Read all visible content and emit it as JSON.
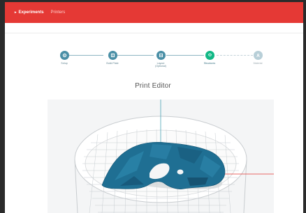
{
  "topbar": {
    "items": [
      {
        "label": "Experiments",
        "active": true
      },
      {
        "label": "Printers",
        "active": false
      }
    ],
    "color": "#e53935"
  },
  "stepper": {
    "steps": [
      {
        "label": "Setup",
        "state": "done",
        "icon": "gear-icon"
      },
      {
        "label": "Build Plate",
        "state": "done",
        "icon": "plate-icon"
      },
      {
        "label": "Layout\n(Optional)",
        "state": "done",
        "icon": "layout-icon"
      },
      {
        "label": "Structures",
        "state": "current",
        "icon": "structures-icon"
      },
      {
        "label": "Material",
        "state": "future",
        "icon": "material-icon"
      }
    ]
  },
  "page": {
    "title": "Print Editor"
  },
  "viewport": {
    "model_color": "#1f6f93",
    "x_axis_color": "#e53935",
    "y_axis_color": "#4aa3b5"
  }
}
